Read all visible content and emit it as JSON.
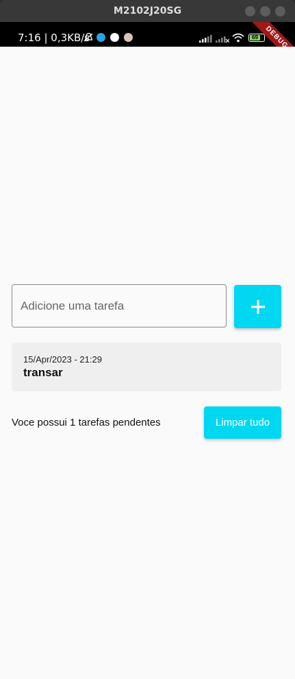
{
  "window": {
    "title": "M2102J20SG"
  },
  "status_bar": {
    "time_speed": "7:16 | 0,3KB/s",
    "battery": "69",
    "debug_label": "DEBUG"
  },
  "task_input": {
    "placeholder": "Adicione uma tarefa",
    "value": ""
  },
  "add_button": {
    "label": "+"
  },
  "tasks": [
    {
      "date": "15/Apr/2023 - 21:29",
      "title": "transar"
    }
  ],
  "footer": {
    "pending_text": "Voce possui 1 tarefas pendentes",
    "clear_label": "Limpar tudo"
  },
  "colors": {
    "accent": "#00d8f2",
    "card": "#efefef",
    "background": "#fafafa"
  }
}
